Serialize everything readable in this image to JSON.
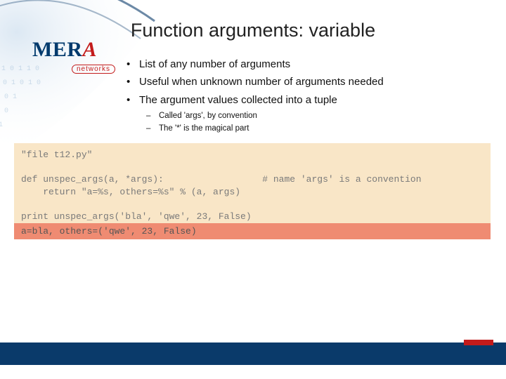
{
  "title": "Function arguments: variable",
  "logo": {
    "text": "MER",
    "tail": "A",
    "sub": "networks"
  },
  "bullets": [
    "List of any number of arguments",
    "Useful when unknown number of arguments needed",
    "The argument values collected into a tuple"
  ],
  "subbullets": [
    "Called 'args', by convention",
    "The '*' is the magical part"
  ],
  "code": "\"file t12.py\"\n\ndef unspec_args(a, *args):                  # name 'args' is a convention\n    return \"a=%s, others=%s\" % (a, args)\n\nprint unspec_args('bla', 'qwe', 23, False)",
  "output": "a=bla, others=('qwe', 23, False)"
}
